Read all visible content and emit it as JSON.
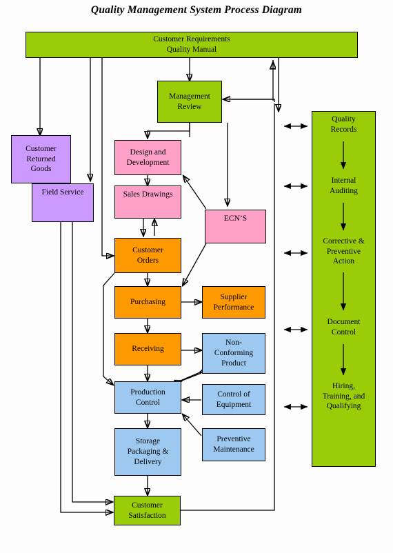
{
  "title": "Quality Management System Process Diagram",
  "colors": {
    "green": "#9ACD08",
    "pink": "#FFA0C8",
    "purple": "#CC99FF",
    "orange": "#FF9900",
    "blue": "#9DC9F0",
    "border": "#000000",
    "background": "#FDFDFD"
  },
  "nodes": {
    "customer_requirements": {
      "label": "Customer Requirements\nQuality Manual",
      "line1": "Customer Requirements",
      "line2": "Quality Manual",
      "color": "green"
    },
    "management_review": {
      "line1": "Management",
      "line2": "Review",
      "color": "green"
    },
    "customer_returned_goods": {
      "line1": "Customer",
      "line2": "Returned",
      "line3": "Goods",
      "color": "purple"
    },
    "field_service": {
      "line1": "Field Service",
      "color": "purple"
    },
    "design_and_development": {
      "line1": "Design and",
      "line2": "Development",
      "color": "pink"
    },
    "sales_drawings": {
      "line1": "Sales Drawings",
      "color": "pink"
    },
    "ecns": {
      "line1": "ECN’S",
      "color": "pink"
    },
    "customer_orders": {
      "line1": "Customer",
      "line2": "Orders",
      "color": "orange"
    },
    "purchasing": {
      "line1": "Purchasing",
      "color": "orange"
    },
    "supplier_performance": {
      "line1": "Supplier",
      "line2": "Performance",
      "color": "orange"
    },
    "receiving": {
      "line1": "Receiving",
      "color": "orange"
    },
    "non_conforming_product": {
      "line1": "Non-",
      "line2": "Conforming",
      "line3": "Product",
      "color": "blue"
    },
    "production_control": {
      "line1": "Production",
      "line2": "Control",
      "color": "blue"
    },
    "control_of_equipment": {
      "line1": "Control of",
      "line2": "Equipment",
      "color": "blue"
    },
    "storage_packaging_delivery": {
      "line1": "Storage",
      "line2": "Packaging &",
      "line3": "Delivery",
      "color": "blue"
    },
    "preventive_maintenance": {
      "line1": "Preventive",
      "line2": "Maintenance",
      "color": "blue"
    },
    "customer_satisfaction": {
      "line1": "Customer",
      "line2": "Satisfaction",
      "color": "green"
    },
    "support_column": {
      "color": "green"
    }
  },
  "support_column_items": [
    {
      "line1": "Quality",
      "line2": "Records"
    },
    {
      "line1": "Internal",
      "line2": "Auditing"
    },
    {
      "line1": "Corrective &",
      "line2": "Preventive",
      "line3": "Action"
    },
    {
      "line1": "Document",
      "line2": "Control"
    },
    {
      "line1": "Hiring,",
      "line2": "Training, and",
      "line3": "Qualifying"
    }
  ]
}
